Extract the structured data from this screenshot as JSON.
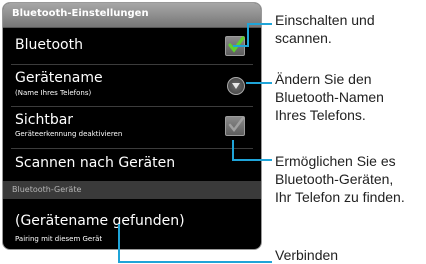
{
  "title": "Bluetooth-Einstellungen",
  "items": {
    "bluetooth": {
      "label": "Bluetooth",
      "checked": true
    },
    "device_name": {
      "label": "Gerätename",
      "sub": "(Name Ihres Telefons)"
    },
    "visible": {
      "label": "Sichtbar",
      "sub": "Geräteerkennung deaktivieren",
      "checked": false
    },
    "scan": {
      "label": "Scannen nach Geräten"
    }
  },
  "section_header": "Bluetooth-Geräte",
  "found_device": {
    "label": "(Gerätename gefunden)",
    "sub": "Pairing mit diesem Gerät"
  },
  "annotations": {
    "a1_l1": "Einschalten und",
    "a1_l2": "scannen.",
    "a2_l1": "Ändern Sie den",
    "a2_l2": "Bluetooth-Namen",
    "a2_l3": "Ihres Telefons.",
    "a3_l1": "Ermöglichen Sie es",
    "a3_l2": "Bluetooth-Geräten,",
    "a3_l3": "Ihr Telefon zu finden.",
    "a4_l1": "Verbinden"
  },
  "colors": {
    "check_green": "#5fd12d",
    "callout_line": "#1fa4d8"
  }
}
